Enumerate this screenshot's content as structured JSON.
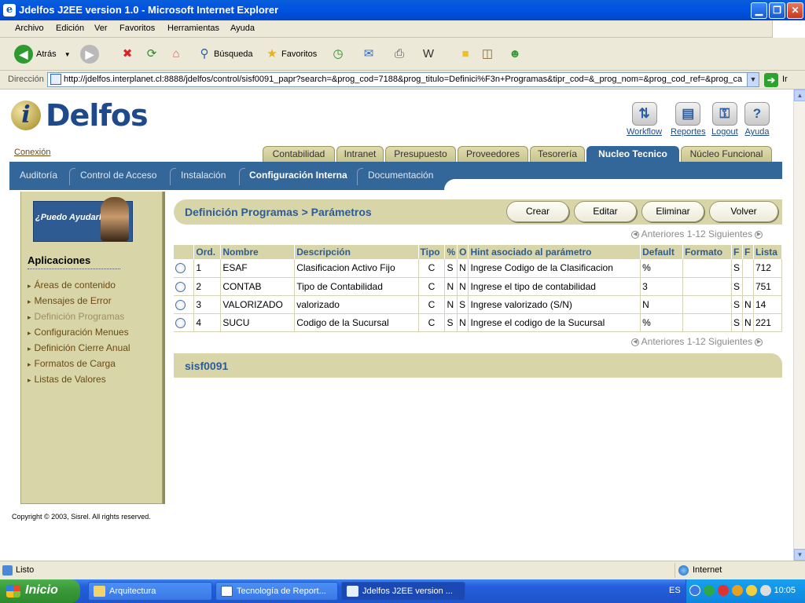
{
  "window": {
    "title": "Jdelfos J2EE version 1.0 - Microsoft Internet Explorer"
  },
  "menu": [
    "Archivo",
    "Edición",
    "Ver",
    "Favoritos",
    "Herramientas",
    "Ayuda"
  ],
  "toolbar": {
    "back": "Atrás",
    "search": "Búsqueda",
    "favorites": "Favoritos"
  },
  "address": {
    "label": "Dirección",
    "url": "http://jdelfos.interplanet.cl:8888/jdelfos/control/sisf0091_papr?search=&prog_cod=7188&prog_titulo=Definici%F3n+Programas&tipr_cod=&_prog_nom=&prog_cod_ref=&prog_ca",
    "go": "Ir"
  },
  "app": {
    "logo": "Delfos",
    "logo_letter": "i",
    "global_links": [
      {
        "label": "Workflow",
        "icon": "workflow-icon",
        "glyph": "⇅"
      },
      {
        "label": "Reportes",
        "icon": "reportes-icon",
        "glyph": "▤"
      },
      {
        "label": "Logout",
        "icon": "key-icon",
        "glyph": "⚿"
      },
      {
        "label": "Ayuda",
        "icon": "help-icon",
        "glyph": "?"
      }
    ],
    "conexion": "Conexión",
    "tabs": [
      "Contabilidad",
      "Intranet",
      "Presupuesto",
      "Proveedores",
      "Tesorería",
      "Nucleo Tecnico",
      "Núcleo Funcional"
    ],
    "active_tab": "Nucleo Tecnico",
    "subtabs": [
      "Auditoría",
      "Control de Acceso",
      "Instalación",
      "Configuración Interna",
      "Documentación"
    ],
    "active_subtab": "Configuración Interna"
  },
  "sidebar": {
    "help": "¿Puedo Ayudarle ?",
    "title": "Aplicaciones",
    "items": [
      "Áreas de contenido",
      "Mensajes de Error",
      "Definición Programas",
      "Configuración Menues",
      "Definición Cierre Anual",
      "Formatos de Carga",
      "Listas de Valores"
    ],
    "current": "Definición Programas"
  },
  "page": {
    "title": "Definición Programas > Parámetros",
    "buttons": [
      "Crear",
      "Editar",
      "Eliminar",
      "Volver"
    ],
    "pager": "Anteriores 1-12 Siguientes",
    "footer": "sisf0091"
  },
  "table": {
    "columns": [
      "Ord.",
      "Nombre",
      "Descripción",
      "Tipo",
      "%",
      "O",
      "Hint asociado al parámetro",
      "Default",
      "Formato",
      "F",
      "F",
      "Lista"
    ],
    "rows": [
      [
        "1",
        "ESAF",
        "Clasificacion Activo Fijo",
        "C",
        "S",
        "N",
        "Ingrese Codigo de la Clasificacion",
        "%",
        "",
        "S",
        "",
        "712"
      ],
      [
        "2",
        "CONTAB",
        "Tipo de Contabilidad",
        "C",
        "N",
        "N",
        "Ingrese el tipo de contabilidad",
        "3",
        "",
        "S",
        "",
        "751"
      ],
      [
        "3",
        "VALORIZADO",
        "valorizado",
        "C",
        "N",
        "S",
        "Ingrese valorizado (S/N)",
        "N",
        "",
        "S",
        "N",
        "14"
      ],
      [
        "4",
        "SUCU",
        "Codigo de la Sucursal",
        "C",
        "S",
        "N",
        "Ingrese el codigo de la Sucursal",
        "%",
        "",
        "S",
        "N",
        "221"
      ]
    ]
  },
  "copyright": "Copyright © 2003, Sisrel. All rights reserved.",
  "status": {
    "text": "Listo",
    "zone": "Internet"
  },
  "taskbar": {
    "start": "Inicio",
    "tasks": [
      "Arquitectura",
      "Tecnología de Report...",
      "Jdelfos J2EE version ..."
    ],
    "lang": "ES",
    "clock": "10:05"
  }
}
